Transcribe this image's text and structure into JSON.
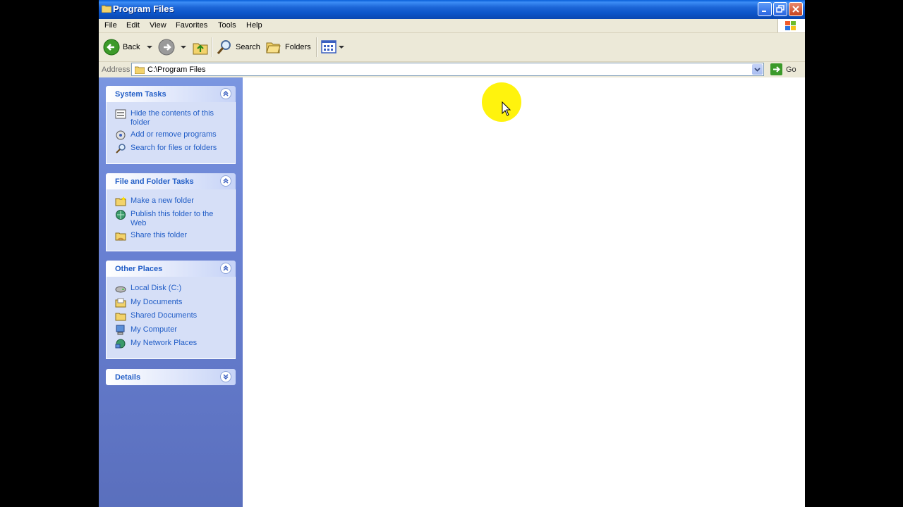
{
  "window": {
    "title": "Program Files"
  },
  "menu": {
    "items": [
      "File",
      "Edit",
      "View",
      "Favorites",
      "Tools",
      "Help"
    ]
  },
  "toolbar": {
    "back_label": "Back",
    "search_label": "Search",
    "folders_label": "Folders"
  },
  "address": {
    "label": "Address",
    "value": "C:\\Program Files",
    "go_label": "Go"
  },
  "sidebar": {
    "system_tasks": {
      "title": "System Tasks",
      "items": [
        {
          "label": "Hide the contents of this folder",
          "icon": "hide-contents-icon"
        },
        {
          "label": "Add or remove programs",
          "icon": "add-remove-programs-icon"
        },
        {
          "label": "Search for files or folders",
          "icon": "search-icon"
        }
      ]
    },
    "file_folder_tasks": {
      "title": "File and Folder Tasks",
      "items": [
        {
          "label": "Make a new folder",
          "icon": "new-folder-icon"
        },
        {
          "label": "Publish this folder to the Web",
          "icon": "publish-web-icon"
        },
        {
          "label": "Share this folder",
          "icon": "share-folder-icon"
        }
      ]
    },
    "other_places": {
      "title": "Other Places",
      "items": [
        {
          "label": "Local Disk (C:)",
          "icon": "local-disk-icon"
        },
        {
          "label": "My Documents",
          "icon": "my-documents-icon"
        },
        {
          "label": "Shared Documents",
          "icon": "shared-documents-icon"
        },
        {
          "label": "My Computer",
          "icon": "my-computer-icon"
        },
        {
          "label": "My Network Places",
          "icon": "my-network-places-icon"
        }
      ]
    },
    "details": {
      "title": "Details"
    }
  },
  "colors": {
    "title_bar": "#0c55c9",
    "link_blue": "#215dc6",
    "sidebar_bg": "#6a82d4",
    "panel_body": "#d6dff7",
    "cursor_highlight": "#fff200"
  }
}
